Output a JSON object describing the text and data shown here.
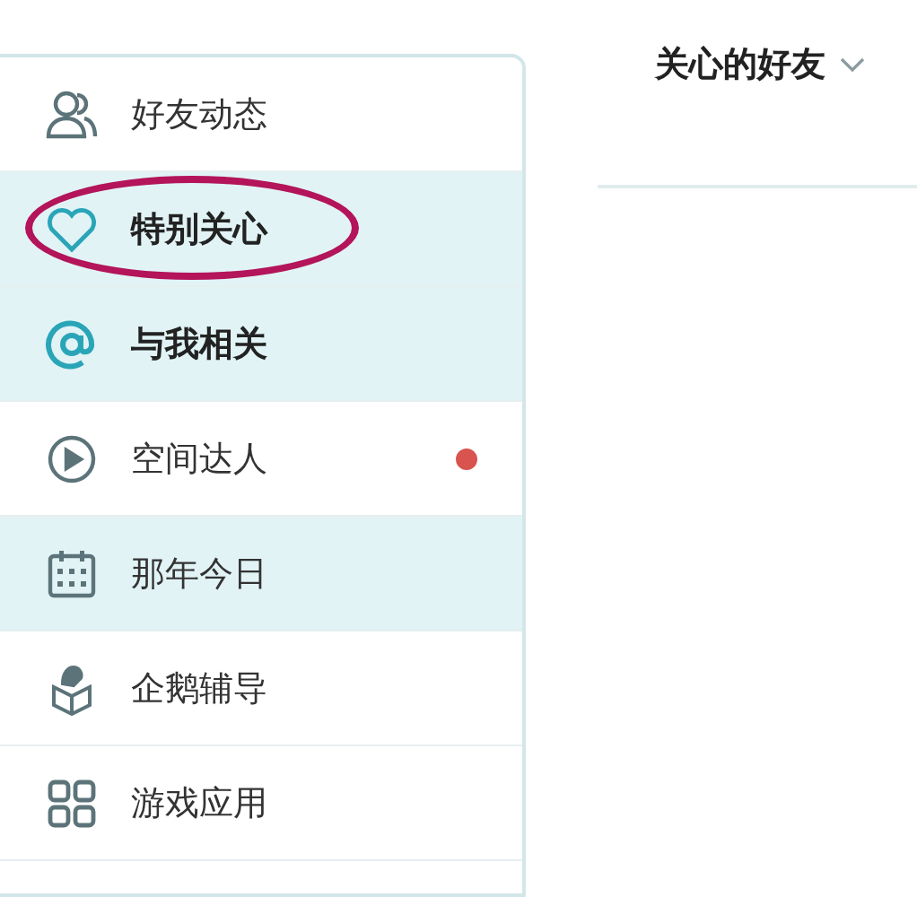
{
  "sidebar": {
    "items": [
      {
        "label": "好友动态",
        "highlighted": false,
        "bold": false,
        "unread": false,
        "circled": false
      },
      {
        "label": "特别关心",
        "highlighted": true,
        "bold": true,
        "unread": false,
        "circled": true
      },
      {
        "label": "与我相关",
        "highlighted": true,
        "bold": true,
        "unread": false,
        "circled": false
      },
      {
        "label": "空间达人",
        "highlighted": false,
        "bold": false,
        "unread": true,
        "circled": false
      },
      {
        "label": "那年今日",
        "highlighted": true,
        "bold": false,
        "unread": false,
        "circled": false
      },
      {
        "label": "企鹅辅导",
        "highlighted": false,
        "bold": false,
        "unread": false,
        "circled": false
      },
      {
        "label": "游戏应用",
        "highlighted": false,
        "bold": false,
        "unread": false,
        "circled": false
      }
    ]
  },
  "header": {
    "title": "关心的好友"
  }
}
